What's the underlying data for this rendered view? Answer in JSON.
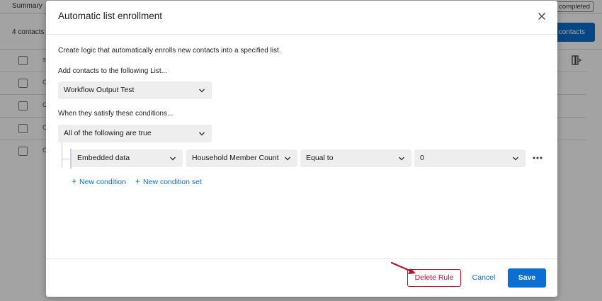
{
  "background": {
    "tab_label": "Summary",
    "status_label": "completed",
    "contacts_count": "4 contacts",
    "add_button_label": "contacts",
    "row_cells": [
      "s",
      "C",
      "C",
      "C",
      "C"
    ]
  },
  "modal": {
    "title": "Automatic list enrollment",
    "description": "Create logic that automatically enrolls new contacts into a specified list.",
    "list_label": "Add contacts to the following List...",
    "list_value": "Workflow Output Test",
    "conditions_label": "When they satisfy these conditions...",
    "match_value": "All of the following are true",
    "condition": {
      "field_type": "Embedded data",
      "field_name": "Household Member Count",
      "operator": "Equal to",
      "value": "0"
    },
    "new_condition_label": "New condition",
    "new_condition_set_label": "New condition set",
    "delete_label": "Delete Rule",
    "cancel_label": "Cancel",
    "save_label": "Save"
  },
  "colors": {
    "accent": "#0b6ed0",
    "danger": "#c8102e",
    "annotation_arrow": "#b0182a"
  }
}
